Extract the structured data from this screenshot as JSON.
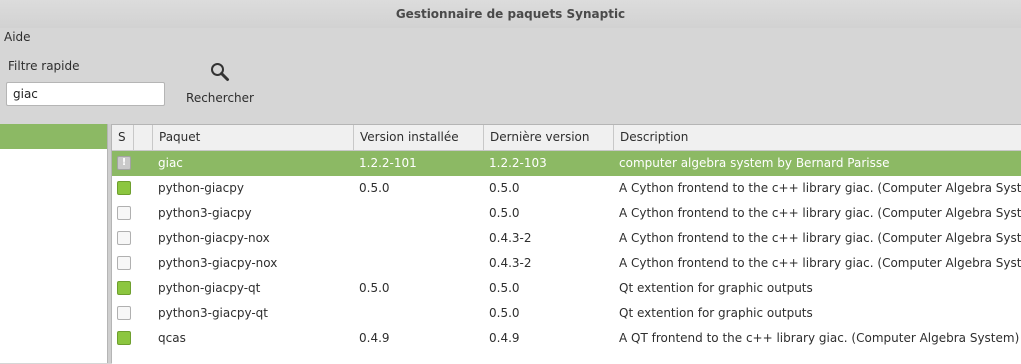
{
  "window": {
    "title": "Gestionnaire de paquets Synaptic"
  },
  "menubar": {
    "items": [
      "Aide"
    ]
  },
  "toolbar": {
    "filter_label": "Filtre rapide",
    "filter_value": "giac",
    "search_label": "Rechercher"
  },
  "table": {
    "columns": {
      "status": "S",
      "package": "Paquet",
      "installed": "Version installée",
      "latest": "Dernière version",
      "description": "Description"
    },
    "rows": [
      {
        "status": "upgradable",
        "status_glyph": "!",
        "package": "giac",
        "installed": "1.2.2-101",
        "latest": "1.2.2-103",
        "description": "computer algebra system by Bernard Parisse"
      },
      {
        "status": "installed",
        "package": "python-giacpy",
        "installed": "0.5.0",
        "latest": "0.5.0",
        "description": "A Cython frontend to the c++ library giac. (Computer Algebra System)"
      },
      {
        "status": "not-installed",
        "package": "python3-giacpy",
        "installed": "",
        "latest": "0.5.0",
        "description": "A Cython frontend to the c++ library giac. (Computer Algebra System)"
      },
      {
        "status": "not-installed",
        "package": "python-giacpy-nox",
        "installed": "",
        "latest": "0.4.3-2",
        "description": "A Cython frontend to the c++ library giac. (Computer Algebra System)"
      },
      {
        "status": "not-installed",
        "package": "python3-giacpy-nox",
        "installed": "",
        "latest": "0.4.3-2",
        "description": "A Cython frontend to the c++ library giac. (Computer Algebra System)"
      },
      {
        "status": "installed",
        "package": "python-giacpy-qt",
        "installed": "0.5.0",
        "latest": "0.5.0",
        "description": "Qt extention for graphic outputs"
      },
      {
        "status": "not-installed",
        "package": "python3-giacpy-qt",
        "installed": "",
        "latest": "0.5.0",
        "description": "Qt extention for graphic outputs"
      },
      {
        "status": "installed",
        "package": "qcas",
        "installed": "0.4.9",
        "latest": "0.4.9",
        "description": "A QT frontend to the c++ library giac. (Computer Algebra System)"
      }
    ]
  },
  "colors": {
    "selection": "#8cb964",
    "installed_box": "#8cc63f",
    "upgradable_box": "#c9c9c9"
  },
  "icons": {
    "search": "magnifier-icon"
  }
}
